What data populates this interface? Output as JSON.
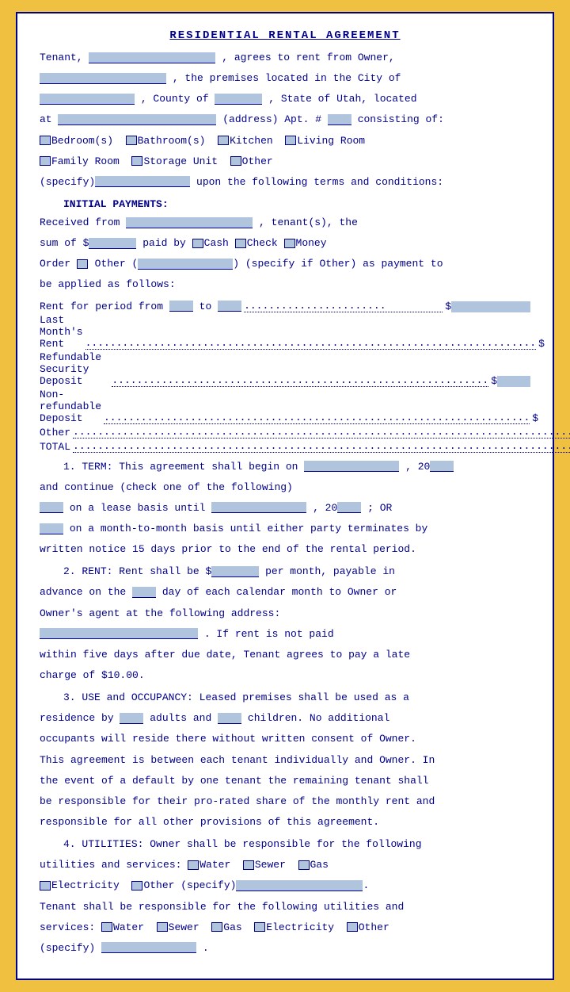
{
  "title": "RESIDENTIAL RENTAL AGREEMENT",
  "intro": {
    "line1": "Tenant,",
    "line1b": ", agrees to rent from Owner,",
    "line2a": ", the premises located in the City of",
    "line2b": ", County of",
    "line2c": ", State of Utah, located",
    "line3a": "at",
    "line3b": "(address) Apt. #",
    "line3c": "consisting of:"
  },
  "rooms": {
    "bedroom": "Bedroom(s)",
    "bathroom": "Bathroom(s)",
    "kitchen": "Kitchen",
    "livingRoom": "Living Room",
    "familyRoom": "Family Room",
    "storageUnit": "Storage Unit",
    "other": "Other",
    "specify": "(specify)",
    "terms": "upon the following terms and conditions:"
  },
  "initialPayments": {
    "heading": "INITIAL PAYMENTS:",
    "line1a": "Received from",
    "line1b": ", tenant(s), the",
    "line1c": "sum of $",
    "line1d": "paid by",
    "cash": "Cash",
    "check": "Check",
    "money": "Money",
    "order": "Order",
    "other": "Other (",
    "otherEnd": ") (specify if Other) as payment to",
    "applied": "be applied as follows:"
  },
  "rentRows": {
    "rentPeriod": "Rent for period from",
    "to": "to",
    "lastMonth": "Last Month's Rent",
    "security": "Refundable Security Deposit",
    "nonRefundable": "Non-refundable Deposit",
    "other": "Other",
    "total": "TOTAL"
  },
  "term": {
    "number": "1.",
    "label": "TERM:",
    "text1": "This agreement shall begin on",
    "text2": ", 20",
    "text3": "and continue (check one of the following)",
    "text4a": "on a lease basis until",
    "text4b": ", 20",
    "text4c": "; OR",
    "text5": "on a month-to-month basis until either party terminates by",
    "text6": "written notice 15 days prior to the end of the rental period."
  },
  "rent": {
    "number": "2.",
    "label": "RENT:",
    "text1": "Rent shall be $",
    "text2": "per month, payable in",
    "text3": "advance on the",
    "text4": "day of each calendar month to Owner or",
    "text5": "Owner's agent at the following address:",
    "text6": ". If rent is not paid",
    "text7": "within five days after due date, Tenant agrees to pay a late",
    "text8": "charge of $10.00."
  },
  "use": {
    "number": "3.",
    "label": "USE and OCCUPANCY:",
    "text1": "Leased premises shall be used as a",
    "text2": "residence by",
    "adults": "adults and",
    "children": "children. No additional",
    "text3": "occupants will reside there without written consent of Owner.",
    "text4": "This agreement is between each tenant individually and Owner.  In",
    "text5": "the event of a default by one tenant the remaining tenant shall",
    "text6": "be responsible for their pro-rated share of the monthly rent and",
    "text7": "responsible for all other provisions of this agreement."
  },
  "utilities": {
    "number": "4.",
    "label": "UTILITIES:",
    "text1": "Owner shall be responsible for the following",
    "text2": "utilities and services:",
    "water": "Water",
    "sewer": "Sewer",
    "gas": "Gas",
    "electricity": "Electricity",
    "other": "Other (specify)",
    "period": ".",
    "tenantText1": "Tenant shall be responsible for the following utilities and",
    "tenantText2": "services:",
    "water2": "Water",
    "sewer2": "Sewer",
    "gas2": "Gas",
    "electricity2": "Electricity",
    "other2": "Other",
    "specify2": "(specify)",
    "period2": "."
  }
}
